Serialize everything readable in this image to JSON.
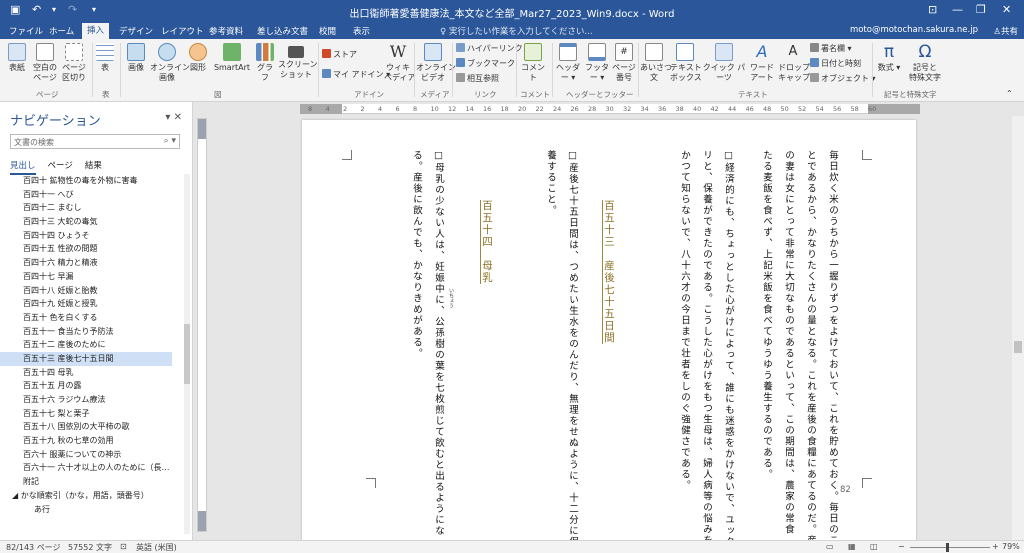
{
  "titlebar": {
    "title": "出口衞師著愛善健康法_本文など全部_Mar27_2023_Win9.docx - Word",
    "undo": "↶",
    "redo": "↷"
  },
  "tabs": [
    "ファイル",
    "ホーム",
    "挿入",
    "デザイン",
    "レイアウト",
    "参考資料",
    "差し込み文書",
    "校閲",
    "表示"
  ],
  "tellme": "♀ 実行したい作業を入力してください...",
  "user": "moto@motochan.sakura.ne.jp",
  "share": "共有",
  "ribbon": {
    "buttons": [
      "表紙",
      "空白の\nページ",
      "ページ\n区切り",
      "表",
      "画像",
      "オンライン\n画像",
      "図形",
      "SmartArt",
      "グラフ",
      "スクリーン\nショット",
      "ウィキ\nペディア",
      "オンライン\nビデオ",
      "コメント",
      "ヘッダー",
      "フッター",
      "ページ\n番号",
      "あいさつ\n文",
      "テキスト\nボックス",
      "クイック パーツ",
      "ワード\nアート",
      "ドロップ\nキャップ",
      "数式",
      "記号と\n特殊文字"
    ],
    "small": [
      "ストア",
      "マイ アドイン",
      "ハイパーリンク",
      "ブックマーク",
      "相互参照",
      "署名欄",
      "日付と時刻",
      "オブジェクト"
    ],
    "groups": [
      "ページ",
      "表",
      "図",
      "アドイン",
      "メディア",
      "リンク",
      "コメント",
      "ヘッダーとフッター",
      "テキスト",
      "記号と特殊文字"
    ]
  },
  "nav": {
    "title": "ナビゲーション",
    "search_placeholder": "文書の検索",
    "tabs": [
      "見出し",
      "ページ",
      "結果"
    ],
    "items": [
      "百四十 鉱物性の毒を外物に害毒",
      "百四十一 へび",
      "百四十二 まむし",
      "百四十三 大蛇の毒気",
      "百四十四 ひょうそ",
      "百四十五 性欲の問題",
      "百四十六 精力と精液",
      "百四十七 早漏",
      "百四十八 妊娠と胎教",
      "百四十九 妊娠と授乳",
      "百五十 色を白くする",
      "百五十一 食当たり予防法",
      "百五十二 産後のために",
      "百五十三 産後七十五日間",
      "百五十四 母乳",
      "百五十五 月の露",
      "百五十六 ラジウム療法",
      "百五十七 梨と栗子",
      "百五十八 国依別の大平柿の歌",
      "百五十九 秋の七草の効用",
      "百六十 服薬についての神示",
      "百六十一 六十才以上の人のために（長…",
      "附記",
      "かな順索引（かな，用語，頭番号）",
      "あ行"
    ],
    "selected_index": 13
  },
  "ruler": [
    "8",
    "4",
    "2",
    "2",
    "4",
    "6",
    "8",
    "10",
    "12",
    "14",
    "16",
    "18",
    "20",
    "22",
    "24",
    "26",
    "28",
    "30",
    "32",
    "34",
    "36",
    "38",
    "40",
    "42",
    "44",
    "46",
    "48",
    "50",
    "52",
    "54",
    "56",
    "58",
    "60"
  ],
  "document": {
    "lines": [
      "毎日炊く米のうちから一握りずつをよけておいて、これを貯めておく。毎日のこ",
      "とであるから、かなりたくさんの量となる。これを産後の食糧にあてるのだ。産後",
      "の妻は女にとって非常に大切なものであるといって、この期間は、農家の常食",
      "たる麦飯を食べず、上記米飯を食べてゆうゆう養生するのである。",
      "□経済的にも、ちょっとした心がけによって、誰にも迷惑をかけないで、ユック",
      "リと、保養ができたのである。こうした心がけをもつ生母は、婦人病等の悩みを",
      "かつて知らないで、八十六才の今日まで壮者をしのぐ強健さである。",
      "百五十三　産後七十五日間",
      "□産後七十五日間は、つめたい生水をのんだり、無理をせぬように、十二分に保",
      "養すること。",
      "百五十四　母乳",
      "□母乳の少ない人は、妊娠中に、公孫樹の葉を七枚煎じて飲むと出るようにな",
      "る。産後に飲んでも、かなりきめがある。"
    ],
    "ruby": "いちょう",
    "page_number": "82"
  },
  "status": {
    "page": "82/143 ページ",
    "words": "57552 文字",
    "lang": "英語 (米国)",
    "zoom": "79%",
    "plus": "+",
    "minus": "−"
  }
}
